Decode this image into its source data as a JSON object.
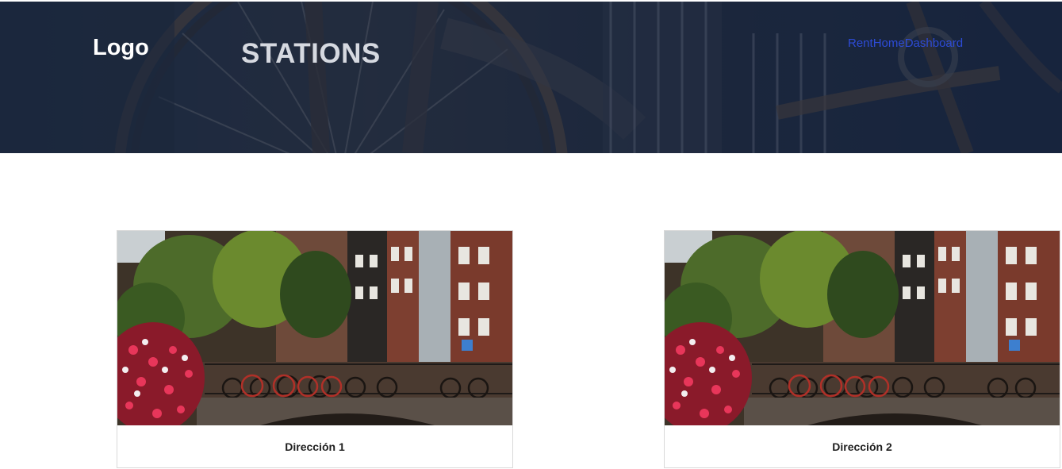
{
  "header": {
    "logo": "Logo",
    "title": "STATIONS",
    "nav": [
      {
        "label": "Rent"
      },
      {
        "label": "Home"
      },
      {
        "label": "Dashboard"
      }
    ],
    "background_icon": "bicycle-photo"
  },
  "stations": [
    {
      "label": "Dirección 1",
      "image": "amsterdam-canal-bikes-photo"
    },
    {
      "label": "Dirección 2",
      "image": "amsterdam-canal-bikes-photo"
    }
  ],
  "colors": {
    "header_overlay": "#101e38",
    "nav_link": "#2d4bd6",
    "logo_text": "#ffffff",
    "title_text": "#d6d9e0",
    "card_border": "#d9d9d9",
    "card_label": "#1f1f1f"
  }
}
